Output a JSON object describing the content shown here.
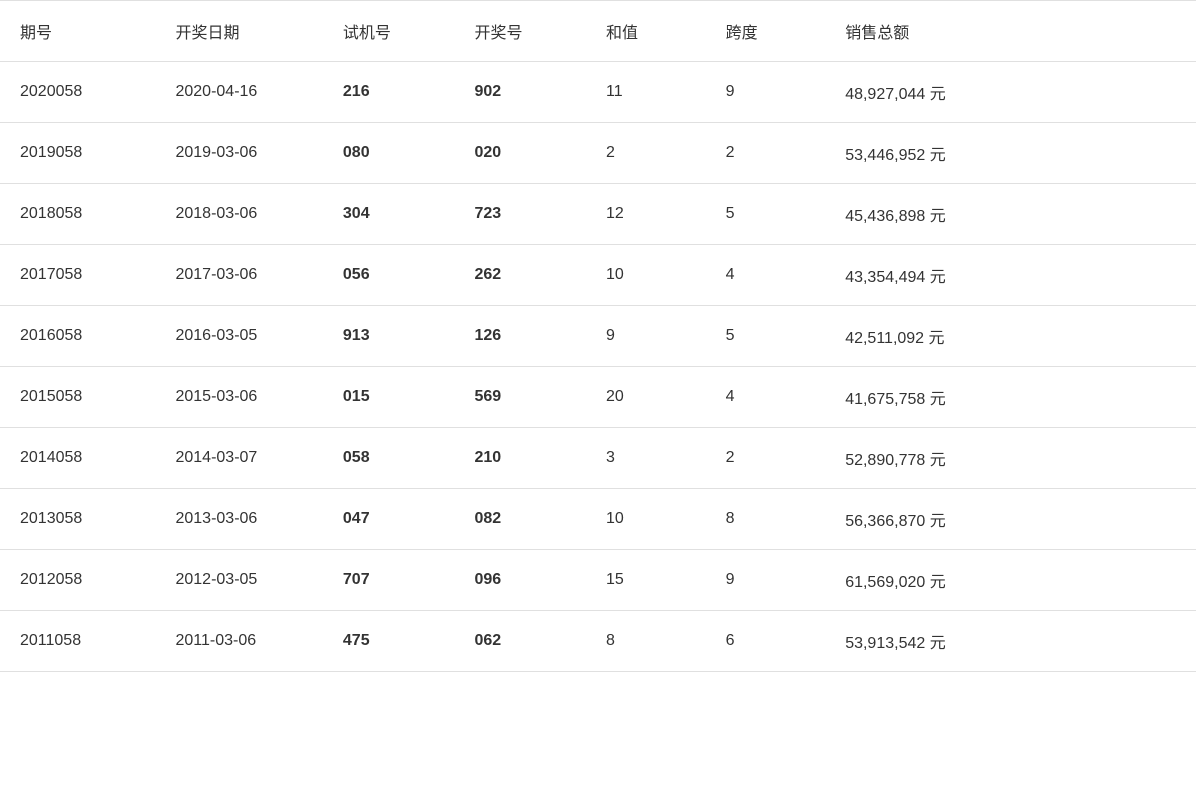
{
  "table": {
    "headers": [
      "期号",
      "开奖日期",
      "试机号",
      "开奖号",
      "和值",
      "跨度",
      "销售总额"
    ],
    "rows": [
      {
        "qihao": "2020058",
        "date": "2020-04-16",
        "shiji": "216",
        "kaijang": "902",
        "hezhi": "11",
        "kuadu": "9",
        "sales": "48,927,044 元"
      },
      {
        "qihao": "2019058",
        "date": "2019-03-06",
        "shiji": "080",
        "kaijang": "020",
        "hezhi": "2",
        "kuadu": "2",
        "sales": "53,446,952 元"
      },
      {
        "qihao": "2018058",
        "date": "2018-03-06",
        "shiji": "304",
        "kaijang": "723",
        "hezhi": "12",
        "kuadu": "5",
        "sales": "45,436,898 元"
      },
      {
        "qihao": "2017058",
        "date": "2017-03-06",
        "shiji": "056",
        "kaijang": "262",
        "hezhi": "10",
        "kuadu": "4",
        "sales": "43,354,494 元"
      },
      {
        "qihao": "2016058",
        "date": "2016-03-05",
        "shiji": "913",
        "kaijang": "126",
        "hezhi": "9",
        "kuadu": "5",
        "sales": "42,511,092 元"
      },
      {
        "qihao": "2015058",
        "date": "2015-03-06",
        "shiji": "015",
        "kaijang": "569",
        "hezhi": "20",
        "kuadu": "4",
        "sales": "41,675,758 元"
      },
      {
        "qihao": "2014058",
        "date": "2014-03-07",
        "shiji": "058",
        "kaijang": "210",
        "hezhi": "3",
        "kuadu": "2",
        "sales": "52,890,778 元"
      },
      {
        "qihao": "2013058",
        "date": "2013-03-06",
        "shiji": "047",
        "kaijang": "082",
        "hezhi": "10",
        "kuadu": "8",
        "sales": "56,366,870 元"
      },
      {
        "qihao": "2012058",
        "date": "2012-03-05",
        "shiji": "707",
        "kaijang": "096",
        "hezhi": "15",
        "kuadu": "9",
        "sales": "61,569,020 元"
      },
      {
        "qihao": "2011058",
        "date": "2011-03-06",
        "shiji": "475",
        "kaijang": "062",
        "hezhi": "8",
        "kuadu": "6",
        "sales": "53,913,542 元"
      }
    ]
  }
}
